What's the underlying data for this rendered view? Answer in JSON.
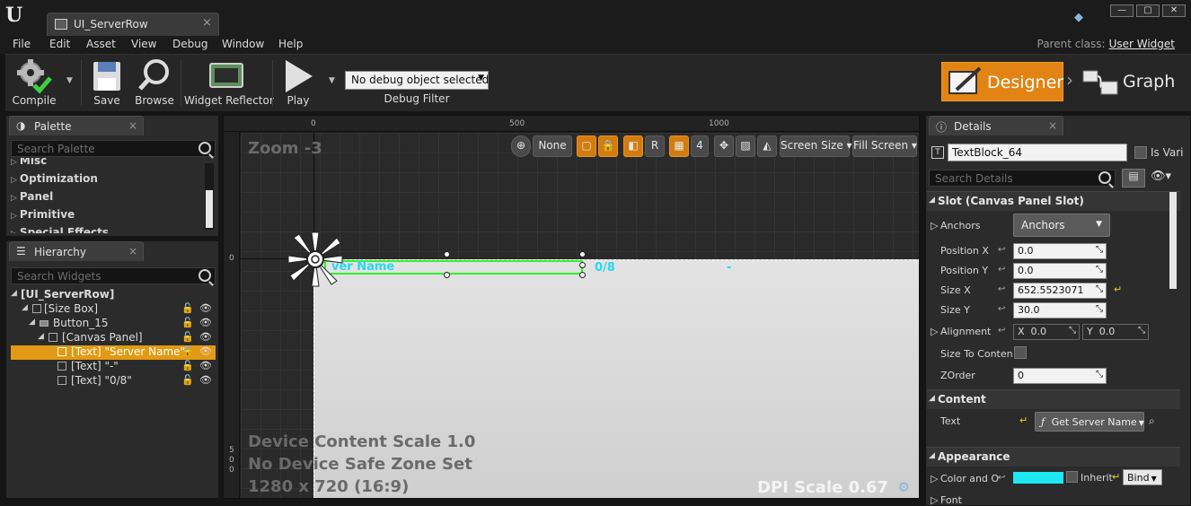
{
  "window": {
    "tab_title": "UI_ServerRow",
    "tab_close": "×",
    "minimize": "—",
    "maximize": "▢",
    "close": "✕"
  },
  "menu": {
    "items": [
      "File",
      "Edit",
      "Asset",
      "View",
      "Debug",
      "Window",
      "Help"
    ],
    "parent_class_label": "Parent class:",
    "parent_class_value": "User Widget"
  },
  "toolbar": {
    "compile": "Compile",
    "save": "Save",
    "browse": "Browse",
    "widget_reflector": "Widget Reflector",
    "play": "Play",
    "debug_object": "No debug object selected",
    "debug_filter": "Debug Filter",
    "designer": "Designer",
    "graph": "Graph"
  },
  "palette": {
    "tab_label": "Palette",
    "search_placeholder": "Search Palette",
    "items": [
      "Misc",
      "Optimization",
      "Panel",
      "Primitive",
      "Special Effects"
    ]
  },
  "hierarchy": {
    "tab_label": "Hierarchy",
    "search_placeholder": "Search Widgets",
    "rows": [
      {
        "label": "[UI_ServerRow]",
        "depth": 0,
        "selected": false
      },
      {
        "label": "[Size Box]",
        "depth": 1,
        "selected": false
      },
      {
        "label": "Button_15",
        "depth": 2,
        "selected": false
      },
      {
        "label": "[Canvas Panel]",
        "depth": 3,
        "selected": false
      },
      {
        "label": "[Text] \"Server Name\"",
        "depth": 4,
        "selected": true
      },
      {
        "label": "[Text] \"-\"",
        "depth": 4,
        "selected": false
      },
      {
        "label": "[Text] \"0/8\"",
        "depth": 4,
        "selected": false
      }
    ]
  },
  "viewport": {
    "zoom": "Zoom -3",
    "ruler_top": [
      "0",
      "500",
      "1000"
    ],
    "ruler_left_0": "0",
    "ruler_left_500": [
      "5",
      "0",
      "0"
    ],
    "toolbar": {
      "none": "None",
      "r": "R",
      "grid_size": "4",
      "screen_size": "Screen Size",
      "fill_screen": "Fill Screen"
    },
    "canvas_texts": {
      "server_name": "ver Name",
      "count": "0/8",
      "dash": "-"
    },
    "overlay": {
      "device_scale": "Device Content Scale 1.0",
      "safe_zone": "No Device Safe Zone Set",
      "resolution": "1280 x 720 (16:9)",
      "dpi": "DPI Scale 0.67"
    }
  },
  "details": {
    "tab_label": "Details",
    "name_value": "TextBlock_64",
    "is_variable": "Is Vari",
    "search_placeholder": "Search Details",
    "slot_section": "Slot (Canvas Panel Slot)",
    "anchors_label": "Anchors",
    "anchors_value": "Anchors",
    "position_x_label": "Position X",
    "position_x": "0.0",
    "position_y_label": "Position Y",
    "position_y": "0.0",
    "size_x_label": "Size X",
    "size_x": "652.5523071",
    "size_y_label": "Size Y",
    "size_y": "30.0",
    "alignment_label": "Alignment",
    "alignment_x_label": "X",
    "alignment_x": "0.0",
    "alignment_y_label": "Y",
    "alignment_y": "0.0",
    "size_to_content_label": "Size To Conten",
    "zorder_label": "ZOrder",
    "zorder": "0",
    "content_section": "Content",
    "text_label": "Text",
    "text_binding": "Get Server Name",
    "appearance_section": "Appearance",
    "color_label": "Color and O",
    "color_value": "#1de8f0",
    "inherit_label": "Inherit",
    "bind_label": "Bind",
    "font_label": "Font"
  },
  "colors": {
    "accent_orange": "#e28414",
    "selection_green": "#2ef02e",
    "text_cyan": "#27d8f0"
  }
}
